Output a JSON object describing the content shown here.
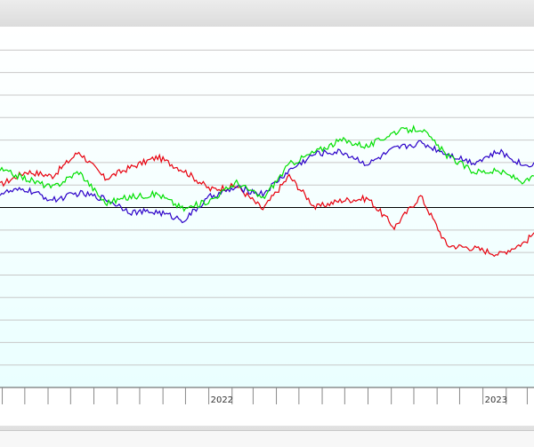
{
  "colors": {
    "background_top": "#ffffff",
    "background_bottom": "#eaffff",
    "gridline": "#c8c8c8",
    "baseline": "#000000",
    "series": [
      "#e8000d",
      "#2b00c8",
      "#00e000"
    ]
  },
  "chart_data": {
    "type": "line",
    "title": "",
    "xlabel": "",
    "ylabel": "",
    "grid": true,
    "x_tick_labels": [
      "2022",
      "2023"
    ],
    "xlim": [
      "2021-03-29",
      "2023-03-10"
    ],
    "x": [
      "2021-03-29",
      "2021-05-03",
      "2021-06-07",
      "2021-07-12",
      "2021-08-16",
      "2021-09-20",
      "2021-10-25",
      "2021-11-29",
      "2022-01-03",
      "2022-02-07",
      "2022-03-14",
      "2022-04-18",
      "2022-05-23",
      "2022-06-27",
      "2022-08-01",
      "2022-09-05",
      "2022-10-10",
      "2022-11-14",
      "2022-12-19",
      "2023-01-23",
      "2023-02-27",
      "2023-03-10"
    ],
    "series": [
      {
        "values": [
          225,
          240,
          235,
          262,
          232,
          245,
          256,
          241,
          220,
          224,
          198,
          235,
          200,
          208,
          210,
          178,
          213,
          158,
          155,
          148,
          162,
          172
        ]
      },
      {
        "values": [
          216,
          220,
          208,
          216,
          210,
          195,
          195,
          186,
          212,
          222,
          215,
          241,
          260,
          262,
          248,
          265,
          272,
          260,
          250,
          262,
          246,
          250
        ]
      },
      {
        "values": [
          242,
          232,
          222,
          240,
          205,
          212,
          215,
          198,
          208,
          228,
          210,
          248,
          262,
          275,
          268,
          284,
          288,
          258,
          240,
          240,
          228,
          235
        ]
      }
    ],
    "ylim": [
      0,
      400
    ]
  }
}
